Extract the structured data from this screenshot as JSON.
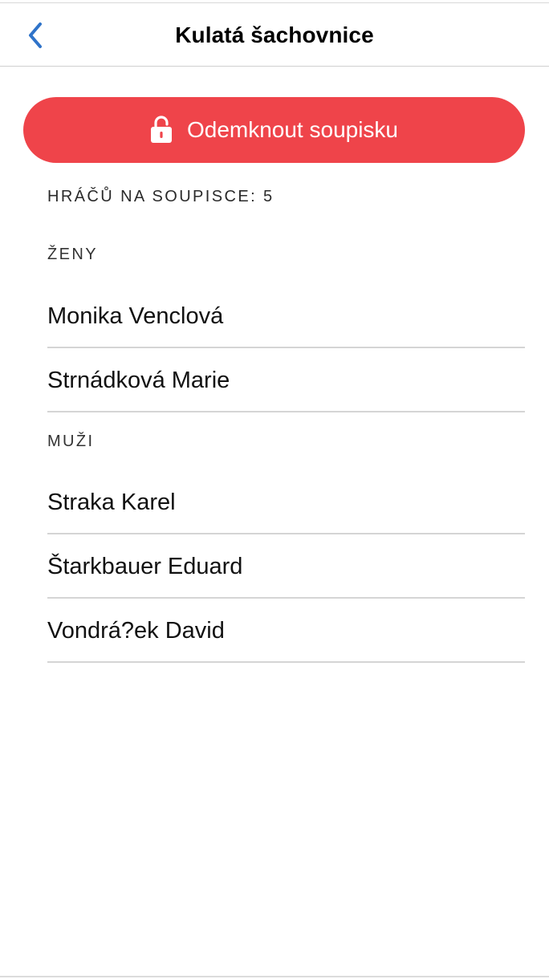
{
  "navbar": {
    "title": "Kulatá šachovnice",
    "back_icon": "chevron-left-icon",
    "accent_color": "#2f73c9"
  },
  "unlock": {
    "label": "Odemknout soupisku",
    "icon": "lock-open-icon",
    "color": "#ef444a"
  },
  "roster": {
    "count_label": "HRÁČŮ NA SOUPISCE: 5",
    "groups": [
      {
        "title": "ŽENY",
        "players": [
          "Monika Venclová",
          "Strnádková Marie"
        ]
      },
      {
        "title": "MUŽI",
        "players": [
          "Straka Karel",
          "Štarkbauer Eduard",
          "Vondrá?ek David"
        ]
      }
    ]
  }
}
